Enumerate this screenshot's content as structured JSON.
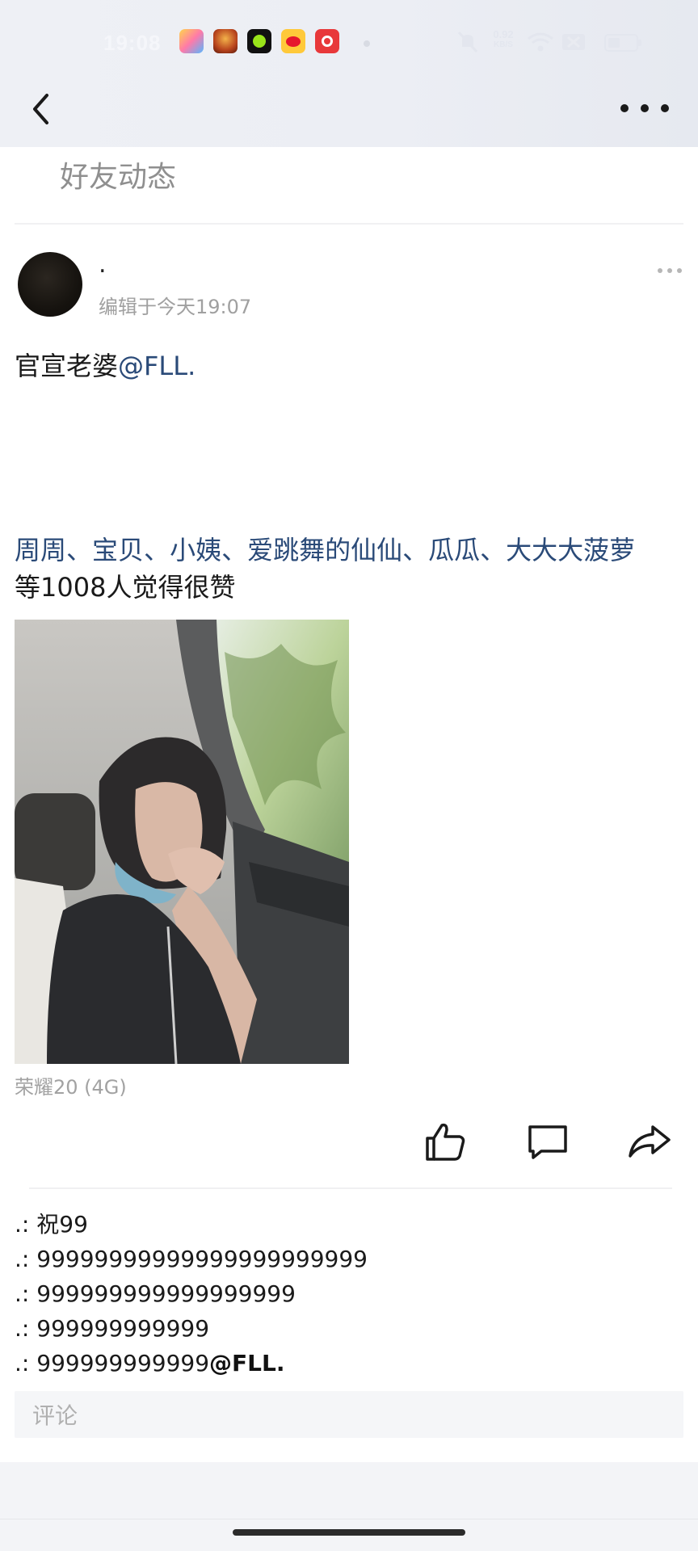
{
  "status_bar": {
    "time": "19:08",
    "net_speed_value": "0.92",
    "net_speed_unit": "KB/S",
    "battery_level": 0.45,
    "app_icons": [
      "comic-app-icon",
      "game-hero-app-icon",
      "green-ring-app-icon",
      "weibo-app-icon",
      "netease-music-app-icon"
    ]
  },
  "header": {
    "back_icon": "chevron-left-icon",
    "more_icon": "more-dots-icon"
  },
  "section": {
    "title": "好友动态"
  },
  "post": {
    "username": ".",
    "edit_time": "编辑于今天19:07",
    "text_prefix": "官宣老婆",
    "mention": "@FLL.",
    "likers": [
      "周周",
      "宝贝",
      "小姨",
      "爱跳舞的仙仙",
      "瓜瓜",
      "大大大菠萝"
    ],
    "separator": "、",
    "like_summary": "等1008人觉得很赞",
    "device": "荣耀20 (4G)"
  },
  "actions": {
    "like_icon": "thumbs-up-icon",
    "comment_icon": "comment-bubble-icon",
    "share_icon": "share-arrow-icon"
  },
  "comments": [
    {
      "author": ".",
      "sep": ": ",
      "text": "祝99",
      "mention": ""
    },
    {
      "author": ".",
      "sep": ": ",
      "text": "99999999999999999999999",
      "mention": ""
    },
    {
      "author": ".",
      "sep": ": ",
      "text": "999999999999999999",
      "mention": ""
    },
    {
      "author": ".",
      "sep": ": ",
      "text": "999999999999",
      "mention": ""
    },
    {
      "author": ".",
      "sep": ": ",
      "text": "999999999999",
      "mention": "@FLL."
    }
  ],
  "comment_input": {
    "placeholder": "评论"
  }
}
